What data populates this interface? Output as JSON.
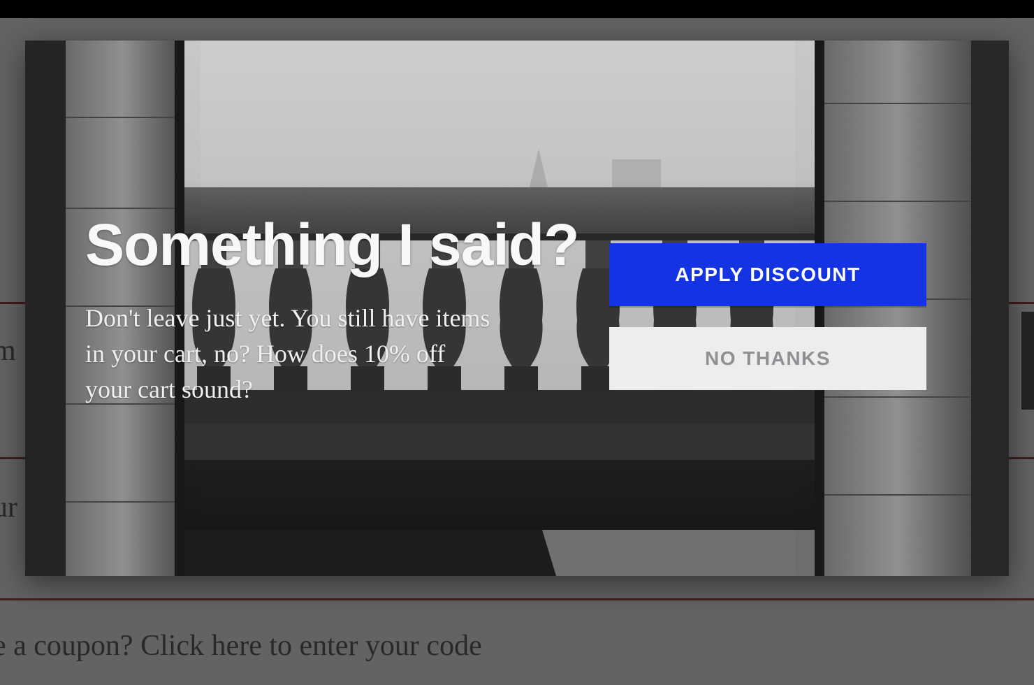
{
  "background": {
    "fragment_left_1": "m",
    "fragment_left_2": "ur",
    "fragment_bottom": "e a coupon? Click here to enter your code"
  },
  "modal": {
    "title": "Something I said?",
    "body": "Don't leave just yet. You still have items in your cart, no? How does 10% off your cart sound?",
    "apply_label": "APPLY DISCOUNT",
    "decline_label": "NO THANKS"
  },
  "colors": {
    "primary_button": "#1434e3",
    "secondary_button": "#eceded",
    "accent_rule": "#7a0000"
  }
}
